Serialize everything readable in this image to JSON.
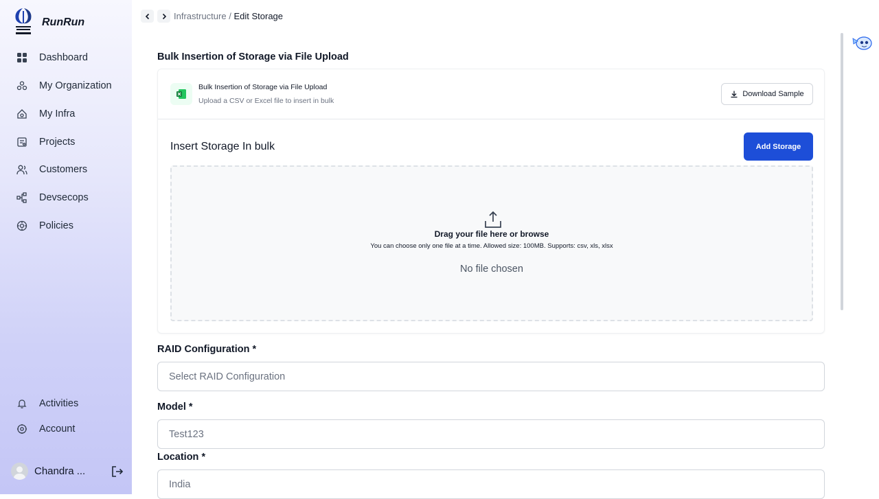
{
  "app": {
    "name": "RunRun"
  },
  "sidebar": {
    "items": [
      {
        "label": "Dashboard",
        "icon": "dashboard-icon"
      },
      {
        "label": "My Organization",
        "icon": "organization-icon"
      },
      {
        "label": "My Infra",
        "icon": "infra-icon"
      },
      {
        "label": "Projects",
        "icon": "projects-icon"
      },
      {
        "label": "Customers",
        "icon": "customers-icon"
      },
      {
        "label": "Devsecops",
        "icon": "devsecops-icon"
      },
      {
        "label": "Policies",
        "icon": "policies-icon"
      }
    ],
    "bottom_items": [
      {
        "label": "Activities",
        "icon": "bell-icon"
      },
      {
        "label": "Account",
        "icon": "gear-icon"
      }
    ],
    "user": {
      "name": "Chandra ..."
    }
  },
  "breadcrumb": {
    "parent": "Infrastructure",
    "separator": "/",
    "current": "Edit Storage"
  },
  "upload": {
    "section_title": "Bulk Insertion of Storage via File Upload",
    "card_title": "Bulk Insertion of Storage via File Upload",
    "card_subtitle": "Upload a CSV or Excel file to insert in bulk",
    "download_label": "Download Sample",
    "insert_title": "Insert Storage In bulk",
    "add_button": "Add Storage",
    "drop_title": "Drag your file here or browse",
    "drop_hint": "You can choose only one file at a time. Allowed size: 100MB. Supports: csv, xls, xlsx",
    "file_status": "No file chosen"
  },
  "form": {
    "raid": {
      "label": "RAID Configuration *",
      "placeholder": "Select RAID Configuration"
    },
    "model": {
      "label": "Model *",
      "value": "Test123"
    },
    "location": {
      "label": "Location *",
      "value": "India"
    }
  },
  "colors": {
    "primary": "#1d4ed8",
    "sidebar_top": "#f7f7fe",
    "sidebar_bottom": "#c4c6f6"
  }
}
